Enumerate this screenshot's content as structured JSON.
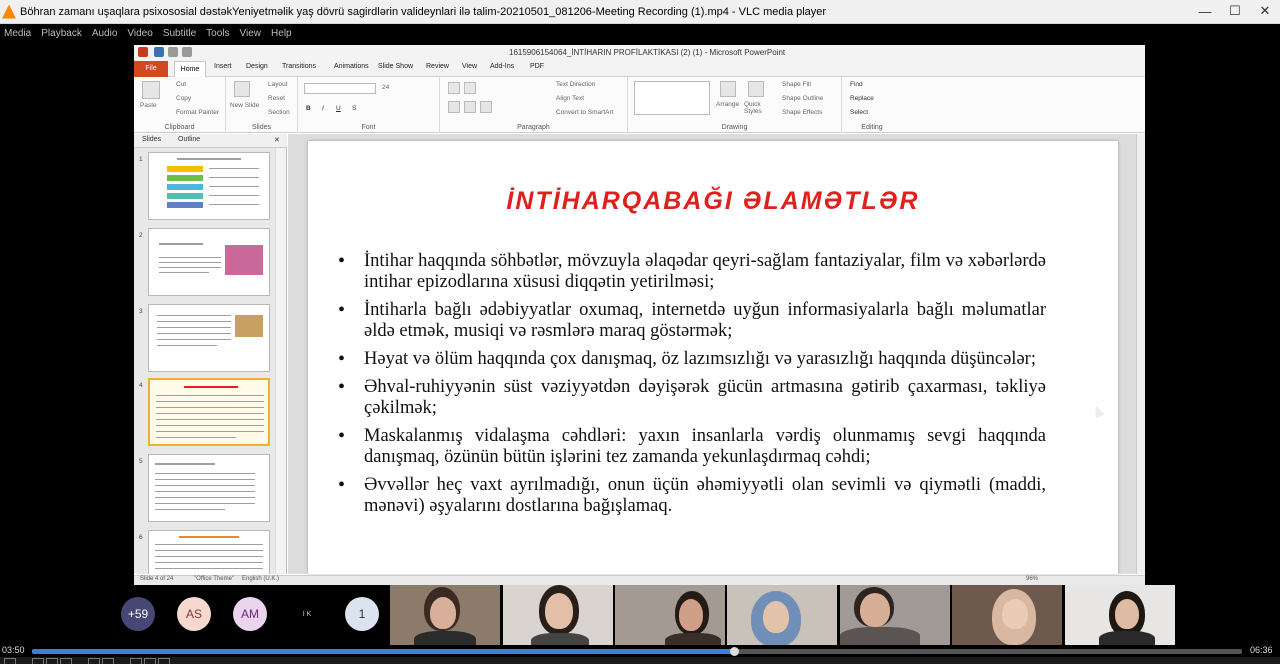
{
  "vlc": {
    "title": "Böhran zamanı uşaqlara psixososial dəstəkYeniyetməlik yaş dövrü sagirdlərin valideynlari ilə talim-20210501_081206-Meeting Recording (1).mp4 - VLC media player",
    "menu": [
      "Media",
      "Playback",
      "Audio",
      "Video",
      "Subtitle",
      "Tools",
      "View",
      "Help"
    ],
    "time_elapsed": "03:50",
    "time_total": "06:36",
    "progress": 0.58
  },
  "ppt": {
    "doc_title": "1615906154064_İNTİHARIN PROFİLAKTİKASI (2) (1) - Microsoft PowerPoint",
    "tabs": [
      "File",
      "Home",
      "Insert",
      "Design",
      "Transitions",
      "Animations",
      "Slide Show",
      "Review",
      "View",
      "Add-Ins",
      "PDF"
    ],
    "ribbon": {
      "clipboard": {
        "label": "Clipboard",
        "paste": "Paste",
        "cut": "Cut",
        "copy": "Copy",
        "format_painter": "Format Painter"
      },
      "slides": {
        "label": "Slides",
        "new_slide": "New Slide",
        "layout": "Layout",
        "reset": "Reset",
        "section": "Section"
      },
      "font": {
        "label": "Font",
        "size": "24"
      },
      "paragraph": {
        "label": "Paragraph",
        "text_direction": "Text Direction",
        "align_text": "Align Text",
        "convert_smartart": "Convert to SmartArt"
      },
      "drawing": {
        "label": "Drawing",
        "arrange": "Arrange",
        "quick_styles": "Quick Styles",
        "shape_fill": "Shape Fill",
        "shape_outline": "Shape Outline",
        "shape_effects": "Shape Effects"
      },
      "editing": {
        "label": "Editing",
        "find": "Find",
        "replace": "Replace",
        "select": "Select"
      }
    },
    "panel_tabs": [
      "Slides",
      "Outline"
    ],
    "thumb_numbers": [
      "1",
      "2",
      "3",
      "4",
      "5",
      "6"
    ],
    "status": {
      "slide": "Slide 4 of 24",
      "theme": "\"Office Theme\"",
      "language": "English (U.K.)",
      "zoom": "96%"
    }
  },
  "slide": {
    "title": "İNTİHARQABAĞI ƏLAMƏTLƏR",
    "bullets": [
      "İntihar haqqında söhbətlər, mövzuyla əlaqədar qeyri-sağlam fantaziyalar, film və xəbərlərdə intihar epizodlarına xüsusi diqqətin yetirilməsi;",
      "İntiharla bağlı ədəbiyyatlar oxumaq, internetdə uyğun informasiyalarla bağlı məlumatlar əldə etmək, musiqi və rəsmlərə maraq göstərmək;",
      "Həyat və ölüm haqqında çox danışmaq, öz lazımsızlığı və yarasızlığı haqqında düşüncələr;",
      "Əhval-ruhiyyənin süst vəziyyətdən dəyişərək gücün artmasına gətirib çaxarması, təkliyə çəkilmək;",
      "Maskalanmış vidalaşma cəhdləri: yaxın insanlarla vərdiş olunmamış sevgi haqqında danışmaq, özünün bütün işlərini tez zamanda yekunlaşdırmaq cəhdi;",
      "Əvvəllər heç vaxt ayrılmadığı, onun üçün əhəmiyyətli olan sevimli və qiymətli (maddi, mənəvi) əşyalarını dostlarına bağışlamaq."
    ]
  },
  "participants": {
    "more": "+59",
    "avatars": [
      "AS",
      "AM"
    ],
    "ik": "I K",
    "raised": "1"
  },
  "colors": {
    "title_red": "#e0201c",
    "file_tab": "#d3491f",
    "seek_fill": "#3c7fd9"
  }
}
